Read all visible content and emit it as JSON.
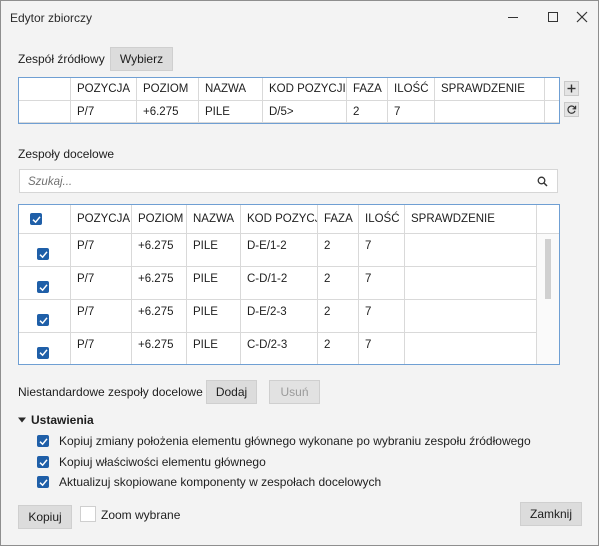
{
  "window": {
    "title": "Edytor zbiorczy"
  },
  "source": {
    "label": "Zespół źródłowy",
    "select_button": "Wybierz",
    "columns": [
      "POZYCJA",
      "POZIOM",
      "NAZWA",
      "KOD POZYCJI",
      "FAZA",
      "ILOŚĆ",
      "SPRAWDZENIE"
    ],
    "row": [
      "P/7",
      "+6.275",
      "PILE",
      "D/5>",
      "2",
      "7",
      ""
    ]
  },
  "target": {
    "label": "Zespoły docelowe",
    "search_placeholder": "Szukaj...",
    "columns": [
      "POZYCJA",
      "POZIOM",
      "NAZWA",
      "KOD POZYCJI",
      "FAZA",
      "ILOŚĆ",
      "SPRAWDZENIE"
    ],
    "rows": [
      [
        "P/7",
        "+6.275",
        "PILE",
        "D-E/1-2",
        "2",
        "7",
        ""
      ],
      [
        "P/7",
        "+6.275",
        "PILE",
        "C-D/1-2",
        "2",
        "7",
        ""
      ],
      [
        "P/7",
        "+6.275",
        "PILE",
        "D-E/2-3",
        "2",
        "7",
        ""
      ],
      [
        "P/7",
        "+6.275",
        "PILE",
        "C-D/2-3",
        "2",
        "7",
        ""
      ]
    ]
  },
  "custom": {
    "label": "Niestandardowe zespoły docelowe",
    "add": "Dodaj",
    "remove": "Usuń"
  },
  "settings": {
    "title": "Ustawienia",
    "options": [
      "Kopiuj zmiany położenia elementu głównego wykonane po wybraniu zespołu źródłowego",
      "Kopiuj właściwości elementu głównego",
      "Aktualizuj skopiowane komponenty w zespołach docelowych"
    ]
  },
  "footer": {
    "copy": "Kopiuj",
    "zoom": "Zoom wybrane",
    "close": "Zamknij"
  },
  "colors": {
    "accent": "#1f5fa8",
    "grid_border": "#6f9fd3",
    "window_bg": "#f3f3f3"
  }
}
